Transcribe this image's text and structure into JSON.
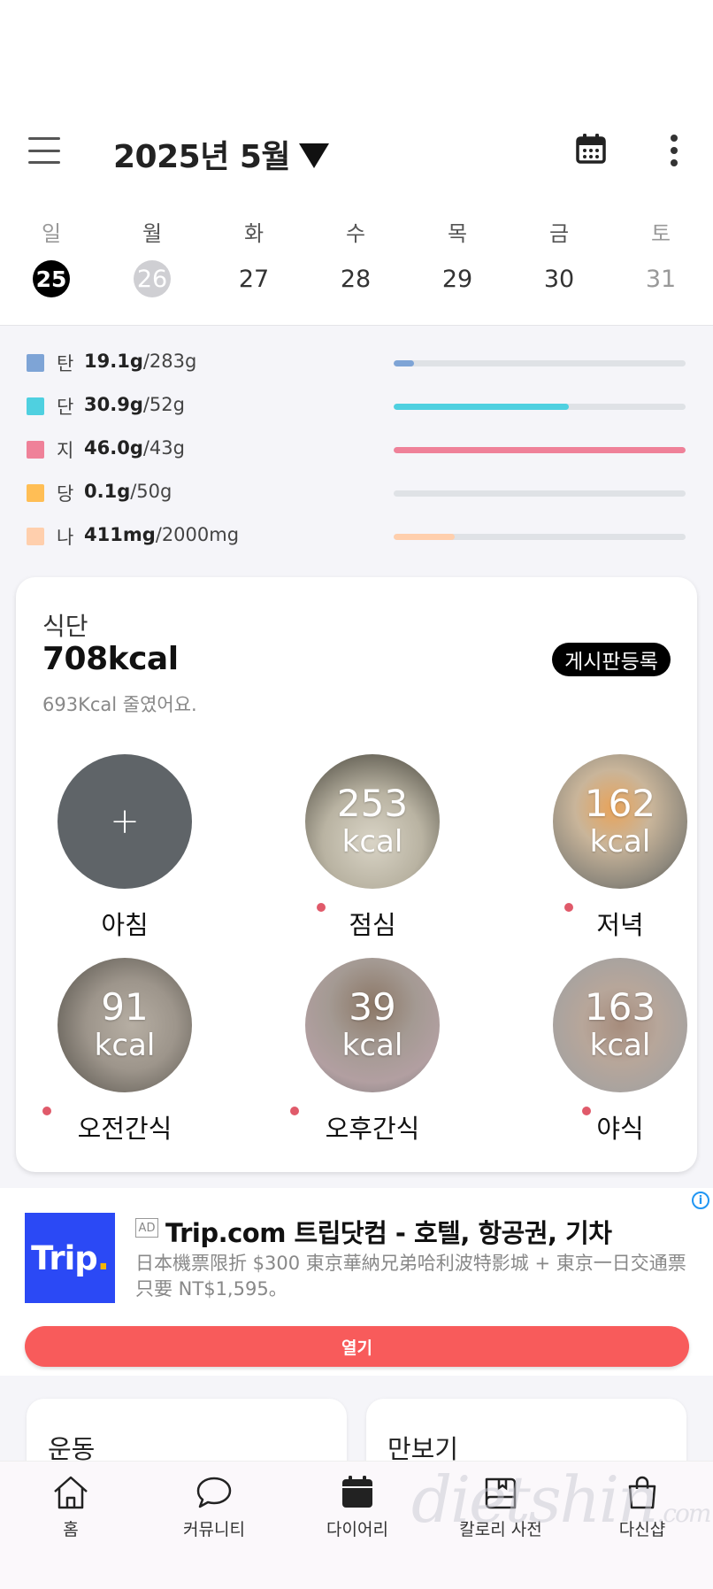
{
  "header": {
    "month_title": "2025년 5월"
  },
  "week": {
    "days": [
      {
        "dow": "일",
        "num": "25"
      },
      {
        "dow": "월",
        "num": "26"
      },
      {
        "dow": "화",
        "num": "27"
      },
      {
        "dow": "수",
        "num": "28"
      },
      {
        "dow": "목",
        "num": "29"
      },
      {
        "dow": "금",
        "num": "30"
      },
      {
        "dow": "토",
        "num": "31"
      }
    ]
  },
  "nutrients": [
    {
      "label": "탄",
      "value": "19.1g",
      "goal": "/283g",
      "color": "#7ea4d6",
      "progress": 0.07
    },
    {
      "label": "단",
      "value": "30.9g",
      "goal": "/52g",
      "color": "#4fd0e0",
      "progress": 0.6
    },
    {
      "label": "지",
      "value": "46.0g",
      "goal": "/43g",
      "color": "#ef8199",
      "progress": 1.0
    },
    {
      "label": "당",
      "value": "0.1g",
      "goal": "/50g",
      "color": "#ffbe55",
      "progress": 0.0
    },
    {
      "label": "나",
      "value": "411mg",
      "goal": "/2000mg",
      "color": "#ffcfad",
      "progress": 0.21
    }
  ],
  "diet": {
    "label": "식단",
    "total": "708kcal",
    "reduced": "693Kcal 줄였어요.",
    "post_button": "게시판등록",
    "add_symbol": "+",
    "meals": [
      {
        "name": "아침",
        "kcal": "",
        "unit": ""
      },
      {
        "name": "점심",
        "kcal": "253",
        "unit": "kcal"
      },
      {
        "name": "저녁",
        "kcal": "162",
        "unit": "kcal"
      },
      {
        "name": "오전간식",
        "kcal": "91",
        "unit": "kcal"
      },
      {
        "name": "오후간식",
        "kcal": "39",
        "unit": "kcal"
      },
      {
        "name": "야식",
        "kcal": "163",
        "unit": "kcal"
      }
    ]
  },
  "ad": {
    "badge": "AD",
    "logo_text": "Trip",
    "logo_dot": ".",
    "title": "Trip.com 트립닷컴 - 호텔, 항공권, 기차",
    "description": "日本機票限折 $300 東京華納兄弟哈利波特影城 + 東京一日交通票只要 NT$1,595。",
    "open_button": "열기",
    "info": "i"
  },
  "cards": {
    "exercise": "운동",
    "pedometer": "만보기"
  },
  "bottom_nav": [
    {
      "label": "홈",
      "icon": "home-icon"
    },
    {
      "label": "커뮤니티",
      "icon": "chat-icon"
    },
    {
      "label": "다이어리",
      "icon": "calendar-icon"
    },
    {
      "label": "칼로리 사전",
      "icon": "book-icon"
    },
    {
      "label": "다신샵",
      "icon": "shopping-bag-icon"
    }
  ],
  "watermark": {
    "text": "dietshin",
    "suffix": ".com"
  }
}
